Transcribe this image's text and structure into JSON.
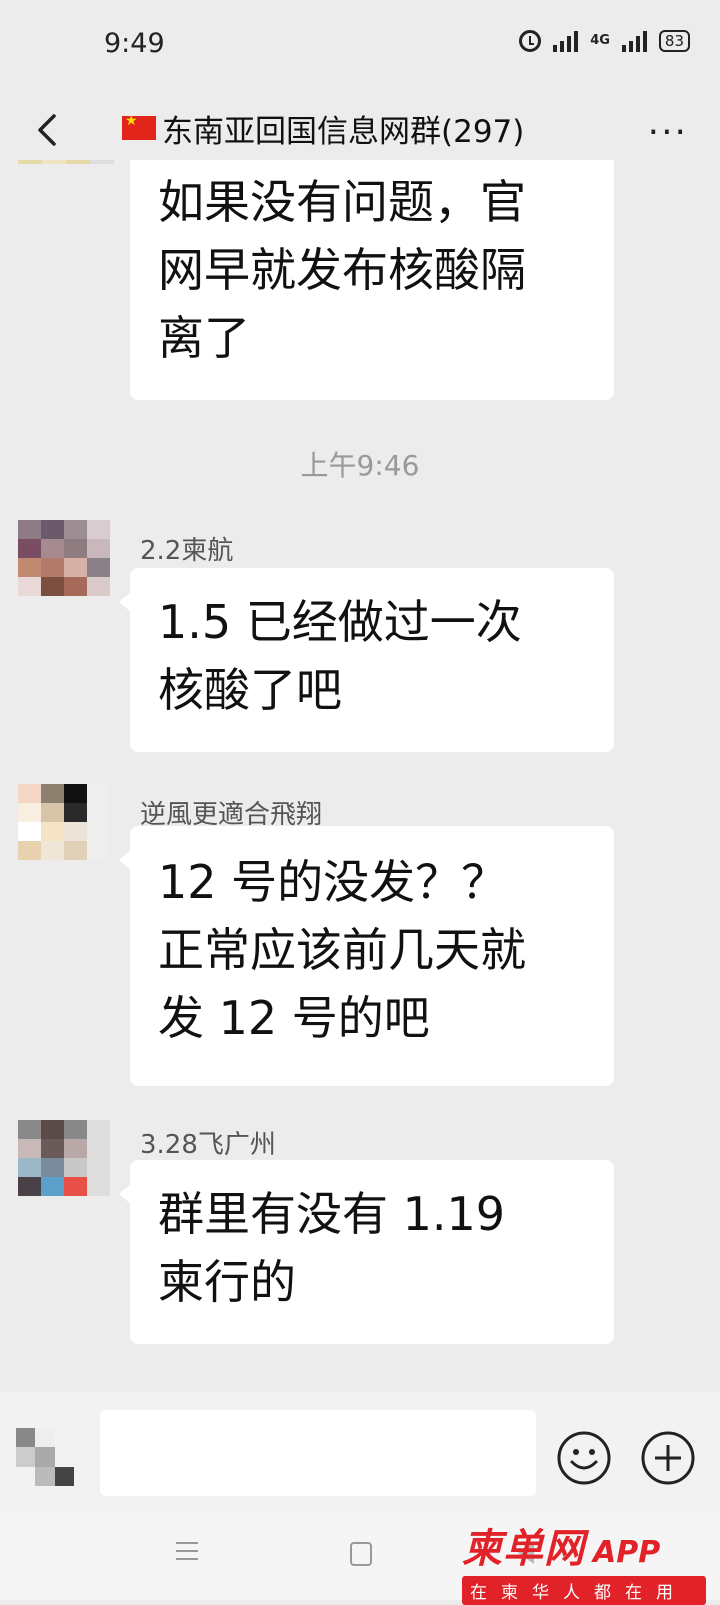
{
  "status_bar": {
    "time": "9:49",
    "network": "4G",
    "battery": "83",
    "icons": [
      "alarm-icon",
      "signal-icon",
      "signal-4g-icon",
      "battery-icon"
    ]
  },
  "header": {
    "back_icon": "chevron-left-icon",
    "flag_icon": "china-flag-emoji",
    "title": "东南亚回国信息网群(297)",
    "more_icon": "more-dots-icon"
  },
  "chat": {
    "messages": [
      {
        "sender": "",
        "text": "如果没有问题，官\n网早就发布核酸隔\n离了"
      },
      {
        "sender": "2.2柬航",
        "text": "1.5 已经做过一次\n核酸了吧"
      },
      {
        "sender": "逆風更適合飛翔",
        "text": "12 号的没发？？\n正常应该前几天就\n发 12 号的吧"
      },
      {
        "sender": "3.28飞广州",
        "text": "群里有没有 1.19\n柬行的"
      }
    ],
    "timestamp": "上午9:46"
  },
  "input_bar": {
    "placeholder": "",
    "emoji_icon": "smile-icon",
    "plus_icon": "plus-icon"
  },
  "watermark": {
    "brand": "柬单网",
    "app": "APP",
    "slogan": "在柬华人都在用"
  },
  "colors": {
    "background": "#ececec",
    "bubble": "#ffffff",
    "watermark_red": "#e12228"
  }
}
